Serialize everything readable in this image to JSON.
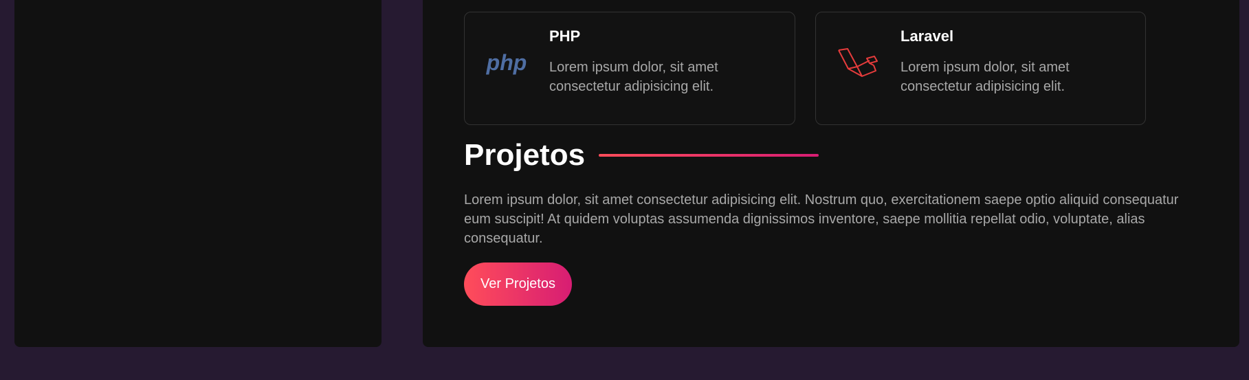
{
  "skills": [
    {
      "title": "PHP",
      "description": "Lorem ipsum dolor, sit amet consectetur adipisicing elit.",
      "icon": "php-icon",
      "icon_text": "php",
      "icon_color": "#4f6ea3"
    },
    {
      "title": "Laravel",
      "description": "Lorem ipsum dolor, sit amet consectetur adipisicing elit.",
      "icon": "laravel-icon",
      "icon_color": "#e63c3c"
    }
  ],
  "projects": {
    "title": "Projetos",
    "description": "Lorem ipsum dolor, sit amet consectetur adipisicing elit. Nostrum quo, exercitationem saepe optio aliquid consequatur eum suscipit! At quidem voluptas assumenda dignissimos inventore, saepe mollitia repellat odio, voluptate, alias consequatur.",
    "button_label": "Ver Projetos"
  },
  "colors": {
    "page_background": "#261a31",
    "panel_background": "#111111",
    "accent_start": "#ff4d5a",
    "accent_end": "#d71d73"
  }
}
